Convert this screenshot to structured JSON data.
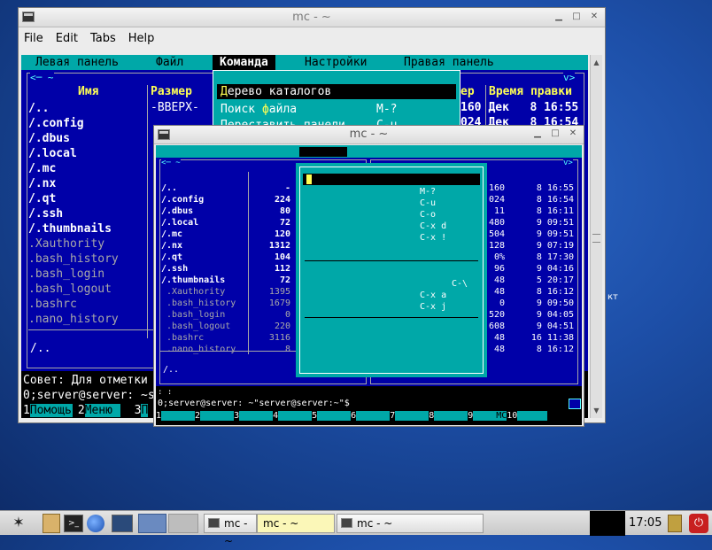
{
  "win1": {
    "title": "mc - ~",
    "menu": [
      "File",
      "Edit",
      "Tabs",
      "Help"
    ],
    "mcmenu": [
      "Левая панель",
      "Файл",
      "Команда",
      "Настройки",
      "Правая панель"
    ],
    "cols": {
      "name": "Имя",
      "size": "Размер",
      "modify_tail": "ер",
      "mtime": "Время правки"
    },
    "files": [
      "/..",
      "/.config",
      "/.dbus",
      "/.local",
      "/.mc",
      "/.nx",
      "/.qt",
      "/.ssh",
      "/.thumbnails",
      " .Xauthority",
      " .bash_history",
      " .bash_login",
      " .bash_logout",
      " .bashrc",
      " .nano_history"
    ],
    "first_size": "-ВВЕРХ-",
    "right_rows": [
      {
        "s": "160",
        "d": "Дек   8 16:55"
      },
      {
        "s": "024",
        "d": "Дек   8 16:54"
      }
    ],
    "dropdown": [
      {
        "label": "Дерево каталогов",
        "key": ""
      },
      {
        "label": "Поиск файла",
        "key": "M-?"
      },
      {
        "label": "Переставить панели",
        "key": "C-u"
      }
    ],
    "status": "/..",
    "hint": "Совет: Для отметки",
    "prompt": "0;server@server: ~s",
    "fkeys": [
      {
        "n": "1",
        "l": "Помощь"
      },
      {
        "n": "2",
        "l": "Меню"
      },
      {
        "n": "3",
        "l": "П"
      }
    ]
  },
  "win2": {
    "title": "mc - ~",
    "files": [
      {
        "n": "/..",
        "s": "-"
      },
      {
        "n": "/.config",
        "s": "224"
      },
      {
        "n": "/.dbus",
        "s": "80"
      },
      {
        "n": "/.local",
        "s": "72"
      },
      {
        "n": "/.mc",
        "s": "120"
      },
      {
        "n": "/.nx",
        "s": "1312"
      },
      {
        "n": "/.qt",
        "s": "104"
      },
      {
        "n": "/.ssh",
        "s": "112"
      },
      {
        "n": "/.thumbnails",
        "s": "72"
      },
      {
        "n": " .Xauthority",
        "s": "1395"
      },
      {
        "n": " .bash_history",
        "s": "1679"
      },
      {
        "n": " .bash_login",
        "s": "0"
      },
      {
        "n": " .bash_logout",
        "s": "220"
      },
      {
        "n": " .bashrc",
        "s": "3116"
      },
      {
        "n": " .nano_history",
        "s": "8"
      }
    ],
    "right": [
      {
        "s": "160",
        "d": " 8 16:55"
      },
      {
        "s": "024",
        "d": " 8 16:54"
      },
      {
        "s": "11",
        "d": " 8 16:11"
      },
      {
        "s": "480",
        "d": " 9 09:51"
      },
      {
        "s": "504",
        "d": " 9 09:51"
      },
      {
        "s": "128",
        "d": " 9 07:19"
      },
      {
        "s": "0%",
        "d": " 8 17:30"
      },
      {
        "s": "96",
        "d": " 9 04:16"
      },
      {
        "s": "48",
        "d": " 5 20:17"
      },
      {
        "s": "48",
        "d": " 8 16:12"
      },
      {
        "s": "0",
        "d": " 9 09:50"
      },
      {
        "s": "520",
        "d": " 9 04:05"
      },
      {
        "s": "608",
        "d": " 9 04:51"
      },
      {
        "s": "48",
        "d": "16 11:38"
      },
      {
        "s": "48",
        "d": " 8 16:12"
      }
    ],
    "keys": [
      "M-?",
      "C-u",
      "C-o",
      "C-x d",
      "C-x !",
      "",
      "",
      "",
      "C-\\",
      "C-x a",
      "C-x j"
    ],
    "status": "/..",
    "prompt": "0;server@server: ~\"server@server:~\"$",
    "fkeys": [
      {
        "n": "1",
        "l": ""
      },
      {
        "n": "2",
        "l": ""
      },
      {
        "n": "3",
        "l": ""
      },
      {
        "n": "4",
        "l": ""
      },
      {
        "n": "5",
        "l": ""
      },
      {
        "n": "6",
        "l": ""
      },
      {
        "n": "7",
        "l": ""
      },
      {
        "n": "8",
        "l": ""
      },
      {
        "n": "9",
        "l": "МС"
      },
      {
        "n": "10",
        "l": ""
      }
    ]
  },
  "taskbar": {
    "tasks": [
      "mc - ~",
      "mc - ~",
      "mc - ~"
    ],
    "clock": "17:05"
  }
}
